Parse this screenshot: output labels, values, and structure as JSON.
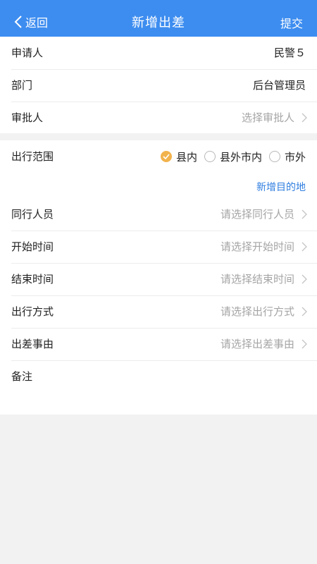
{
  "nav": {
    "back_label": "返回",
    "title": "新增出差",
    "submit_label": "提交",
    "bg_color": "#3d8df0"
  },
  "info": {
    "applicant": {
      "label": "申请人",
      "value": "民警５"
    },
    "department": {
      "label": "部门",
      "value": "后台管理员"
    },
    "approver": {
      "label": "审批人",
      "placeholder": "选择审批人"
    }
  },
  "form": {
    "scope": {
      "label": "出行范围",
      "options": [
        "县内",
        "县外市内",
        "市外"
      ],
      "selected": "县内",
      "checked_color": "#f2b34d"
    },
    "add_destination_label": "新增目的地",
    "companions": {
      "label": "同行人员",
      "placeholder": "请选择同行人员"
    },
    "start_time": {
      "label": "开始时间",
      "placeholder": "请选择开始时间"
    },
    "end_time": {
      "label": "结束时间",
      "placeholder": "请选择结束时间"
    },
    "travel_mode": {
      "label": "出行方式",
      "placeholder": "请选择出行方式"
    },
    "reason": {
      "label": "出差事由",
      "placeholder": "请选择出差事由"
    },
    "remark": {
      "label": "备注"
    }
  }
}
